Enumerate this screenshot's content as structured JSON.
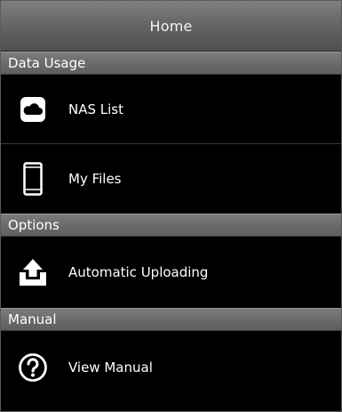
{
  "header": {
    "title": "Home"
  },
  "sections": {
    "data_usage": {
      "label": "Data Usage",
      "items": [
        {
          "label": "NAS List",
          "icon": "cloud-icon"
        },
        {
          "label": "My Files",
          "icon": "smartphone-icon"
        }
      ]
    },
    "options": {
      "label": "Options",
      "items": [
        {
          "label": "Automatic Uploading",
          "icon": "upload-icon"
        }
      ]
    },
    "manual": {
      "label": "Manual",
      "items": [
        {
          "label": "View Manual",
          "icon": "help-icon"
        }
      ]
    }
  },
  "colors": {
    "background": "#000000",
    "bar": "#6b6b6b",
    "text": "#ffffff"
  }
}
